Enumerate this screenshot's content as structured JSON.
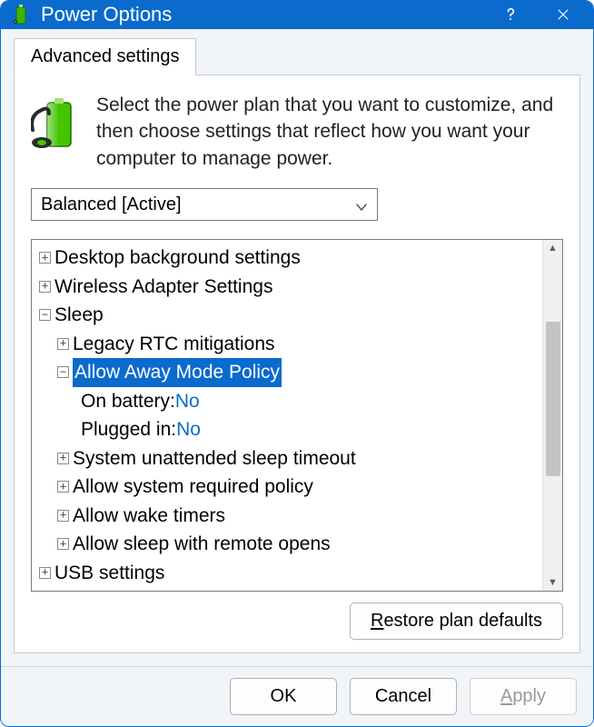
{
  "title": "Power Options",
  "tab_label": "Advanced settings",
  "intro_text": "Select the power plan that you want to customize, and then choose settings that reflect how you want your computer to manage power.",
  "plan_selected": "Balanced [Active]",
  "tree": {
    "desktop_bg": "Desktop background settings",
    "wireless": "Wireless Adapter Settings",
    "sleep": "Sleep",
    "legacy_rtc": "Legacy RTC mitigations",
    "away_mode": "Allow Away Mode Policy",
    "away_mode_battery_label": "On battery: ",
    "away_mode_battery_value": "No",
    "away_mode_plugged_label": "Plugged in: ",
    "away_mode_plugged_value": "No",
    "sys_unattended": "System unattended sleep timeout",
    "sys_required": "Allow system required policy",
    "wake_timers": "Allow wake timers",
    "remote_opens": "Allow sleep with remote opens",
    "usb": "USB settings"
  },
  "restore_label": "Restore plan defaults",
  "buttons": {
    "ok": "OK",
    "cancel": "Cancel",
    "apply": "Apply"
  }
}
